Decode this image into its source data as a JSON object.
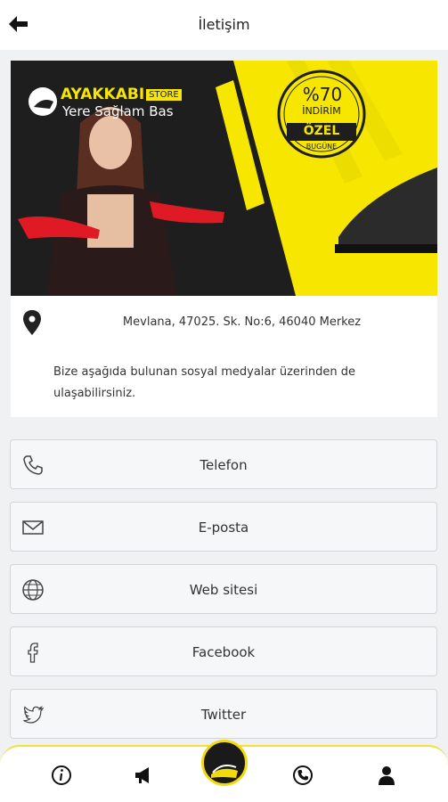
{
  "header": {
    "title": "İletişim"
  },
  "banner": {
    "brand": "AYAKKABI",
    "store": "STORE",
    "slogan": "Yere Sağlam Bas",
    "badge": {
      "percent": "%70",
      "discount": "İNDİRİM",
      "special": "ÖZEL",
      "sub": "BUGÜNE"
    }
  },
  "contact": {
    "address": "Mevlana, 47025. Sk. No:6, 46040 Merkez",
    "note": "Bize aşağıda bulunan sosyal medyalar üzerinden de ulaşabilirsiniz."
  },
  "buttons": [
    {
      "label": "Telefon",
      "icon": "phone-icon"
    },
    {
      "label": "E-posta",
      "icon": "mail-icon"
    },
    {
      "label": "Web sitesi",
      "icon": "globe-icon"
    },
    {
      "label": "Facebook",
      "icon": "facebook-icon"
    },
    {
      "label": "Twitter",
      "icon": "twitter-icon"
    }
  ],
  "tabbar": {
    "items": [
      "info-icon",
      "megaphone-icon",
      "home-logo",
      "phone-circle-icon",
      "person-icon"
    ],
    "accent": "#f4d90b"
  },
  "colors": {
    "yellow": "#f6e600",
    "dark": "#1e1e1e"
  }
}
